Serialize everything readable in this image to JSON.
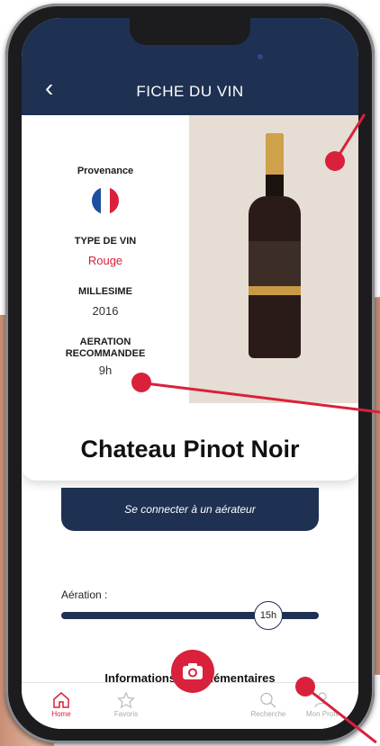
{
  "header": {
    "title": "FICHE DU VIN",
    "back_icon": "chevron-left-icon"
  },
  "wine": {
    "provenance_label": "Provenance",
    "flag_colors": [
      "#1f4fa0",
      "#ffffff",
      "#d9213b"
    ],
    "type_label": "TYPE DE VIN",
    "type_value": "Rouge",
    "millesime_label": "MILLESIME",
    "millesime_value": "2016",
    "aeration_label_1": "AERATION",
    "aeration_label_2": "RECOMMANDEE",
    "aeration_value": "9h",
    "name": "Chateau  Pinot Noir"
  },
  "connect_button": "Se connecter à un aérateur",
  "aeration_slider": {
    "label": "Aération :",
    "value": "15h",
    "level_percent": 76
  },
  "more_info": "Informations complémentaires",
  "tabs": [
    {
      "label": "Home",
      "icon": "home-icon"
    },
    {
      "label": "Favoris",
      "icon": "star-icon"
    },
    {
      "label": "Recherche",
      "icon": "search-icon"
    },
    {
      "label": "Mon Profil",
      "icon": "user-icon"
    }
  ],
  "colors": {
    "navy": "#1f3152",
    "accent": "#d9213b"
  }
}
